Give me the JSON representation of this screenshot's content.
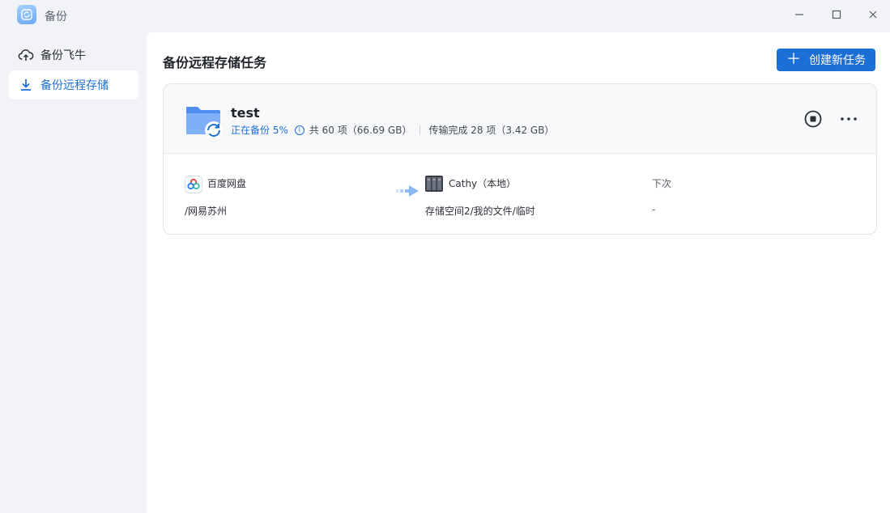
{
  "window": {
    "title": "备份",
    "icons": {
      "app": "backup-app-icon",
      "minimize": "minimize-icon",
      "maximize": "maximize-icon",
      "close": "close-icon"
    }
  },
  "sidebar": {
    "items": [
      {
        "label": "备份飞牛",
        "icon": "cloud-upload-icon",
        "active": false
      },
      {
        "label": "备份远程存储",
        "icon": "download-icon",
        "active": true
      }
    ]
  },
  "main": {
    "title": "备份远程存储任务",
    "create_button": {
      "icon": "plus-icon",
      "label": "创建新任务"
    }
  },
  "task": {
    "name": "test",
    "progress_text": "正在备份 5%",
    "total_text": "共 60 项（66.69 GB）",
    "transferred_text": "传输完成 28 项（3.42 GB）",
    "source": {
      "name": "百度网盘",
      "path": "/网易苏州",
      "icon": "baidu-netdisk-icon"
    },
    "destination": {
      "name": "Cathy（本地）",
      "path": "存储空间2/我的文件/临时",
      "icon": "nas-device-icon"
    },
    "next": {
      "label": "下次",
      "value": "-"
    }
  },
  "colors": {
    "accent": "#1d6fd8",
    "sidebar_bg": "#f1f3f7",
    "card_header_bg": "#f7f8fa"
  }
}
